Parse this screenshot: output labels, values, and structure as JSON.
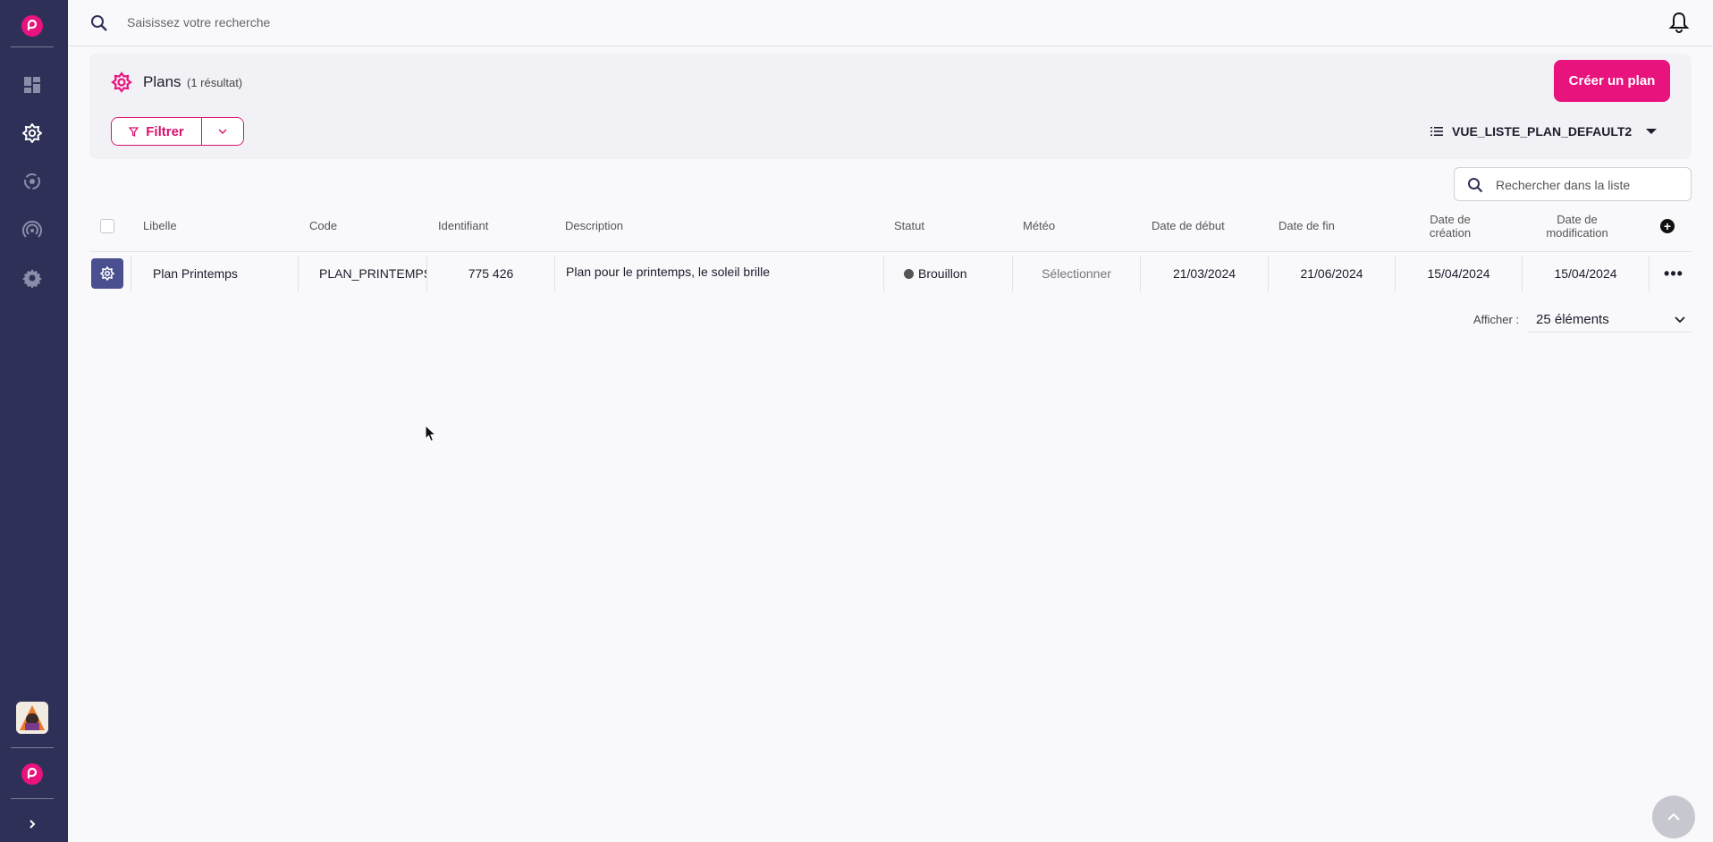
{
  "topbar": {
    "search_placeholder": "Saisissez votre recherche",
    "search_icon": "search-icon",
    "notification_icon": "bell-icon"
  },
  "sidebar": {
    "items": [
      {
        "name": "dashboard",
        "icon": "dashboard-icon"
      },
      {
        "name": "plans",
        "icon": "gear-flower-icon",
        "active": true
      },
      {
        "name": "radar",
        "icon": "radar-icon"
      },
      {
        "name": "broadcast",
        "icon": "broadcast-icon"
      },
      {
        "name": "settings",
        "icon": "gear-icon"
      }
    ],
    "expand_icon": "chevron-right-icon"
  },
  "header": {
    "title": "Plans",
    "count": "(1 résultat)",
    "create_button": "Créer un plan",
    "filter_button": "Filtrer",
    "view_name": "VUE_LISTE_PLAN_DEFAULT2"
  },
  "list_search": {
    "placeholder": "Rechercher dans la liste"
  },
  "table": {
    "columns": {
      "libelle": "Libelle",
      "code": "Code",
      "identifiant": "Identifiant",
      "description": "Description",
      "statut": "Statut",
      "meteo": "Météo",
      "date_debut": "Date de début",
      "date_fin": "Date de fin",
      "date_creation_1": "Date de",
      "date_creation_2": "création",
      "date_modification_1": "Date de",
      "date_modification_2": "modification"
    },
    "rows": [
      {
        "libelle": "Plan Printemps",
        "code": "PLAN_PRINTEMPS",
        "identifiant": "775 426",
        "description": "Plan pour le printemps, le soleil brille",
        "statut": "Brouillon",
        "meteo": "Sélectionner",
        "date_debut": "21/03/2024",
        "date_fin": "21/06/2024",
        "date_creation": "15/04/2024",
        "date_modification": "15/04/2024"
      }
    ]
  },
  "pagination": {
    "label": "Afficher :",
    "selected": "25 éléments"
  },
  "colors": {
    "brand": "#e8137d",
    "sidebar": "#2e3057",
    "row_icon": "#4a4f8f"
  }
}
